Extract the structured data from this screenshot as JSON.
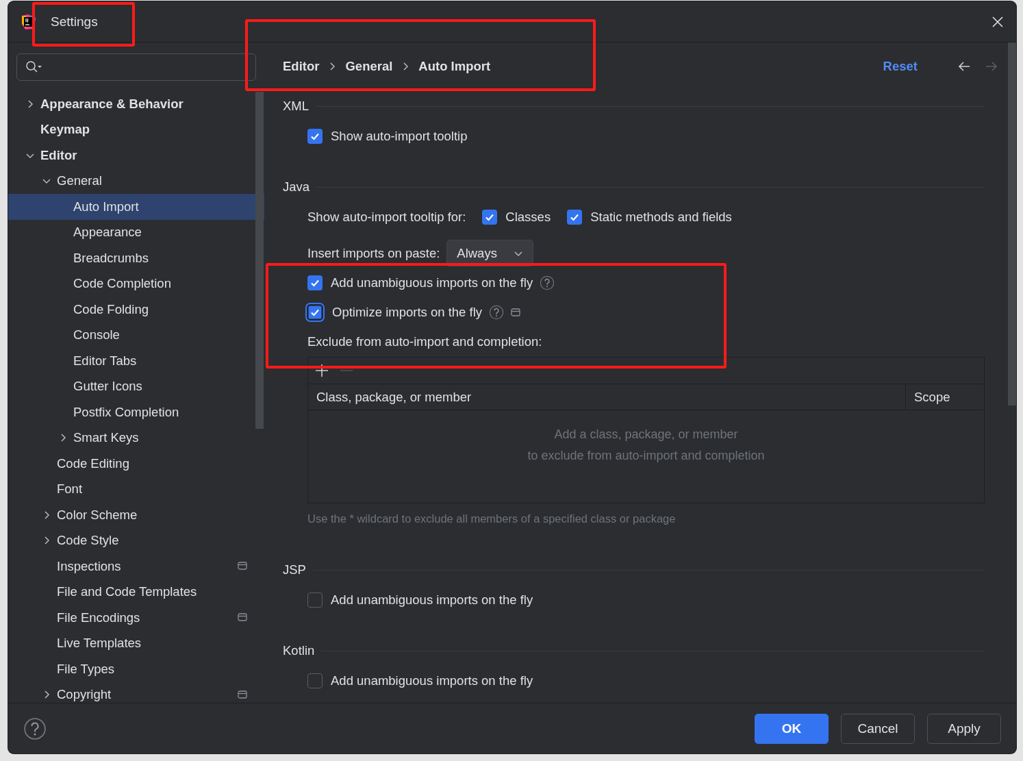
{
  "window": {
    "title": "Settings"
  },
  "sidebar": {
    "items": [
      {
        "label": "Appearance & Behavior",
        "selected": false,
        "expanded": false,
        "project_level": false
      },
      {
        "label": "Keymap",
        "selected": false,
        "project_level": false
      },
      {
        "label": "Editor",
        "selected": false,
        "expanded": true,
        "project_level": false,
        "children": [
          {
            "label": "General",
            "selected": false,
            "expanded": true,
            "project_level": false,
            "children": [
              {
                "label": "Auto Import",
                "selected": true,
                "project_level": false
              },
              {
                "label": "Appearance",
                "selected": false,
                "project_level": false
              },
              {
                "label": "Breadcrumbs",
                "selected": false,
                "project_level": false
              },
              {
                "label": "Code Completion",
                "selected": false,
                "project_level": false
              },
              {
                "label": "Code Folding",
                "selected": false,
                "project_level": false
              },
              {
                "label": "Console",
                "selected": false,
                "project_level": false
              },
              {
                "label": "Editor Tabs",
                "selected": false,
                "project_level": false
              },
              {
                "label": "Gutter Icons",
                "selected": false,
                "project_level": false
              },
              {
                "label": "Postfix Completion",
                "selected": false,
                "project_level": false
              },
              {
                "label": "Smart Keys",
                "selected": false,
                "expanded": false,
                "project_level": false
              }
            ]
          },
          {
            "label": "Code Editing",
            "selected": false,
            "project_level": false
          },
          {
            "label": "Font",
            "selected": false,
            "project_level": false
          },
          {
            "label": "Color Scheme",
            "selected": false,
            "expanded": false,
            "project_level": false
          },
          {
            "label": "Code Style",
            "selected": false,
            "expanded": false,
            "project_level": false
          },
          {
            "label": "Inspections",
            "selected": false,
            "project_level": true
          },
          {
            "label": "File and Code Templates",
            "selected": false,
            "project_level": false
          },
          {
            "label": "File Encodings",
            "selected": false,
            "project_level": true
          },
          {
            "label": "Live Templates",
            "selected": false,
            "project_level": false
          },
          {
            "label": "File Types",
            "selected": false,
            "project_level": false
          },
          {
            "label": "Copyright",
            "selected": false,
            "expanded": false,
            "project_level": true
          }
        ]
      }
    ]
  },
  "breadcrumb": [
    "Editor",
    "General",
    "Auto Import"
  ],
  "reset": "Reset",
  "navigation": {
    "back_disabled": false,
    "forward_disabled": true
  },
  "sections": [
    {
      "title": "XML",
      "rows": [
        {
          "kind": "checkbox",
          "label": "Show auto-import tooltip",
          "checked": true,
          "focused": false,
          "help": false,
          "project_level": false
        }
      ]
    },
    {
      "title": "Java",
      "rows": [
        {
          "kind": "checkbox-group",
          "label": "Show auto-import tooltip for:",
          "options": [
            {
              "label": "Classes",
              "checked": true
            },
            {
              "label": "Static methods and fields",
              "checked": true
            }
          ]
        },
        {
          "kind": "dropdown",
          "label": "Insert imports on paste:",
          "value": "Always"
        },
        {
          "kind": "checkbox",
          "label": "Add unambiguous imports on the fly",
          "checked": true,
          "focused": false,
          "help": true,
          "project_level": false
        },
        {
          "kind": "checkbox",
          "label": "Optimize imports on the fly",
          "checked": true,
          "focused": true,
          "help": true,
          "project_level": true
        },
        {
          "kind": "label",
          "text": "Exclude from auto-import and completion:"
        },
        {
          "kind": "table",
          "remove_disabled": true,
          "columns": [
            "Class, package, or member",
            "Scope"
          ],
          "empty_text": [
            "Add a class, package, or member",
            "to exclude from auto-import and completion"
          ]
        },
        {
          "kind": "hint",
          "text": "Use the * wildcard to exclude all members of a specified class or package"
        }
      ]
    },
    {
      "title": "JSP",
      "rows": [
        {
          "kind": "checkbox",
          "label": "Add unambiguous imports on the fly",
          "checked": false,
          "focused": false,
          "help": false,
          "project_level": false
        }
      ]
    },
    {
      "title": "Kotlin",
      "rows": [
        {
          "kind": "checkbox",
          "label": "Add unambiguous imports on the fly",
          "checked": false,
          "focused": false,
          "help": false,
          "project_level": false
        }
      ]
    }
  ],
  "buttons": [
    {
      "label": "OK",
      "primary": true
    },
    {
      "label": "Cancel",
      "primary": false
    },
    {
      "label": "Apply",
      "primary": false
    }
  ],
  "annotations": [
    {
      "kind": "box"
    },
    {
      "kind": "box"
    },
    {
      "kind": "box"
    }
  ]
}
